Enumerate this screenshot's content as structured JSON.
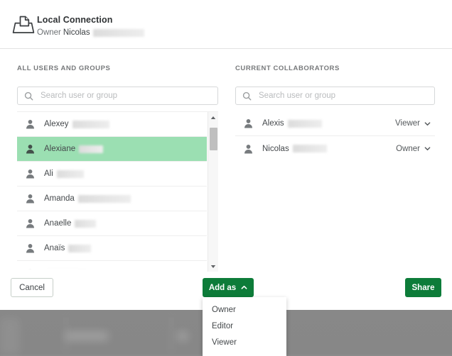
{
  "header": {
    "icon": "data-connection-tray-icon",
    "title": "Local Connection",
    "owner_label": "Owner",
    "owner_name": "Nicolas"
  },
  "left_panel": {
    "label": "ALL USERS AND GROUPS",
    "search": {
      "icon": "search-icon",
      "placeholder": "Search user or group",
      "value": ""
    },
    "users": [
      {
        "name": "Alexey",
        "selected": false,
        "redact_width": 52
      },
      {
        "name": "Alexiane",
        "selected": true,
        "redact_width": 34
      },
      {
        "name": "Ali",
        "selected": false,
        "redact_width": 38
      },
      {
        "name": "Amanda",
        "selected": false,
        "redact_width": 74
      },
      {
        "name": "Anaelle",
        "selected": false,
        "redact_width": 30
      },
      {
        "name": "Anaïs",
        "selected": false,
        "redact_width": 32
      }
    ],
    "scrollbar": {
      "up_icon": "chevron-up-icon",
      "down_icon": "chevron-down-icon"
    }
  },
  "right_panel": {
    "label": "CURRENT COLLABORATORS",
    "search": {
      "icon": "search-icon",
      "placeholder": "Search user or group",
      "value": ""
    },
    "collaborators": [
      {
        "name": "Alexis",
        "role": "Viewer",
        "redact_width": 48
      },
      {
        "name": "Nicolas",
        "role": "Owner",
        "redact_width": 48
      }
    ]
  },
  "footer": {
    "cancel_label": "Cancel",
    "add_as_label": "Add as",
    "share_label": "Share"
  },
  "add_as_menu": {
    "open": true,
    "options": [
      "Owner",
      "Editor",
      "Viewer"
    ]
  },
  "colors": {
    "brand_green": "#0d7c39",
    "selection_green": "#9bdfb2",
    "text_primary": "#44484b",
    "text_muted": "#77797b",
    "border": "#e2e2e2",
    "backdrop": "#8b8b8b"
  }
}
